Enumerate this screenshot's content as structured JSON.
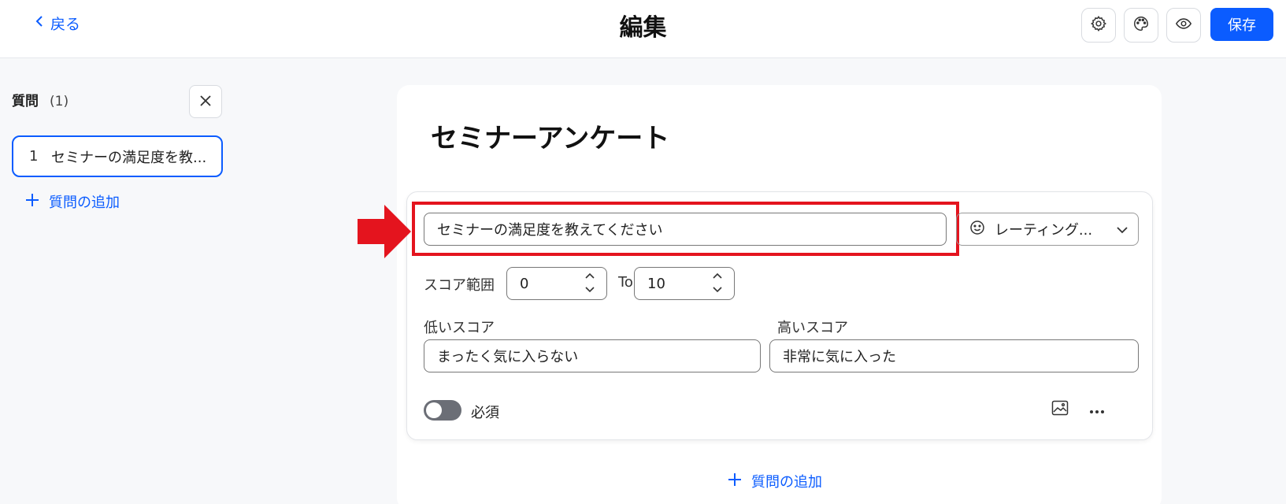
{
  "header": {
    "back_label": "戻る",
    "title": "編集",
    "icons": [
      "gear-icon",
      "palette-icon",
      "eye-icon"
    ],
    "save_label": "保存"
  },
  "sidebar": {
    "heading": "質問",
    "count": "(1)",
    "items": [
      {
        "number": "1",
        "label": "セミナーの満足度を教..."
      }
    ],
    "add_label": "質問の追加"
  },
  "main": {
    "survey_title": "セミナーアンケート",
    "question": {
      "text": "セミナーの満足度を教えてください",
      "type_label": "レーティング...",
      "score_range_label": "スコア範囲",
      "score_min": "0",
      "to_label": "To",
      "score_max": "10",
      "low_label": "低いスコア",
      "low_value": "まったく気に入らない",
      "high_label": "高いスコア",
      "high_value": "非常に気に入った",
      "required_label": "必須",
      "required_on": false
    },
    "add_label": "質問の追加"
  },
  "colors": {
    "accent": "#0b5cff",
    "annotation_red": "#e4141e"
  }
}
